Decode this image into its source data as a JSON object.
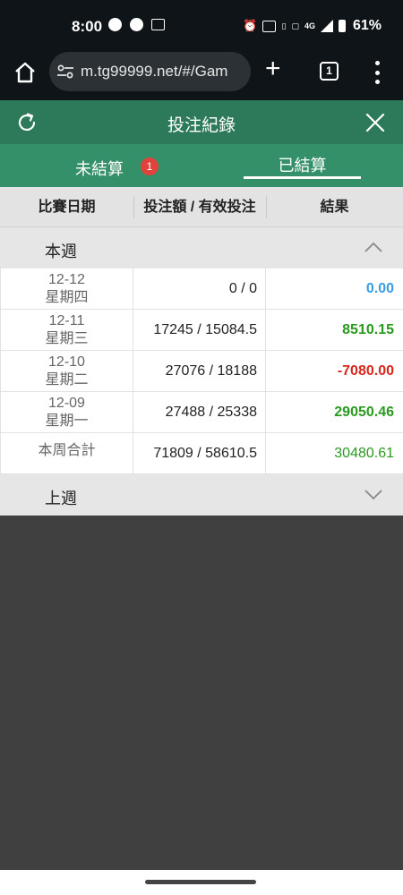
{
  "status_bar": {
    "time": "8:00",
    "network": "4G",
    "battery": "61%"
  },
  "browser": {
    "url": "m.tg99999.net/#/Gam",
    "tab_count": "1"
  },
  "page": {
    "title": "投注紀錄"
  },
  "tabs": {
    "unsettled_label": "未結算",
    "unsettled_badge": "1",
    "settled_label": "已結算"
  },
  "table": {
    "headers": {
      "date": "比賽日期",
      "bet": "投注額 / 有效投注",
      "result": "結果"
    },
    "this_week": {
      "label": "本週",
      "rows": [
        {
          "date": "12-12",
          "weekday": "星期四",
          "bet": "0 / 0",
          "result": "0.00"
        },
        {
          "date": "12-11",
          "weekday": "星期三",
          "bet": "17245 / 15084.5",
          "result": "8510.15"
        },
        {
          "date": "12-10",
          "weekday": "星期二",
          "bet": "27076 / 18188",
          "result": "-7080.00"
        },
        {
          "date": "12-09",
          "weekday": "星期一",
          "bet": "27488 / 25338",
          "result": "29050.46"
        }
      ],
      "total": {
        "label": "本周合計",
        "bet": "71809 / 58610.5",
        "result": "30480.61"
      }
    },
    "last_week": {
      "label": "上週"
    }
  },
  "colors": {
    "header_green": "#2d7a5a",
    "tab_green": "#349068",
    "positive": "#2a9a1f",
    "negative": "#d9261c",
    "zero": "#3b9be0",
    "badge_red": "#e0433b"
  }
}
